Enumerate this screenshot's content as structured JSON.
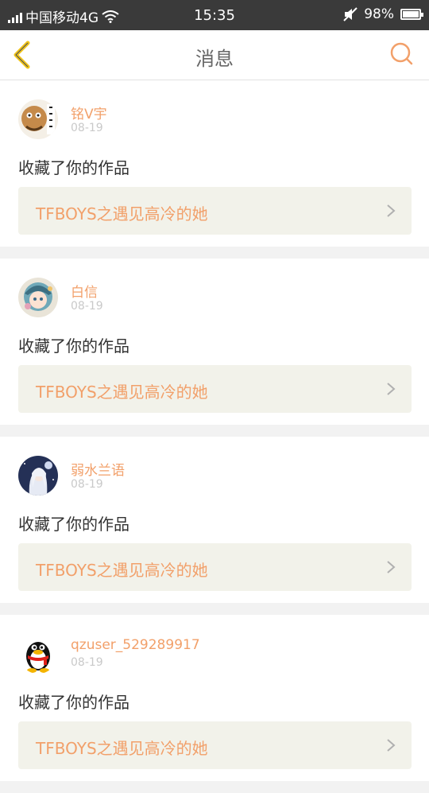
{
  "status_bar": {
    "carrier": "中国移动4G",
    "time": "15:35",
    "battery": "98%",
    "battery_level": 0.98
  },
  "header": {
    "title": "消息",
    "accent_color": "#f2a06a",
    "back_color": "#f0c419"
  },
  "messages": [
    {
      "username": "铭V宇",
      "date": "08-19",
      "action": "收藏了你的作品",
      "work_title": "TFBOYS之遇见高冷的她",
      "avatar": "avatar-image"
    },
    {
      "username": "白信",
      "date": "08-19",
      "action": "收藏了你的作品",
      "work_title": "TFBOYS之遇见高冷的她",
      "avatar": "avatar-image"
    },
    {
      "username": "弱水兰语",
      "date": "08-19",
      "action": "收藏了你的作品",
      "work_title": "TFBOYS之遇见高冷的她",
      "avatar": "avatar-image"
    },
    {
      "username": "qzuser_529289917",
      "date": "08-19",
      "action": "收藏了你的作品",
      "work_title": "TFBOYS之遇见高冷的她",
      "avatar": "qq-penguin-icon"
    }
  ]
}
